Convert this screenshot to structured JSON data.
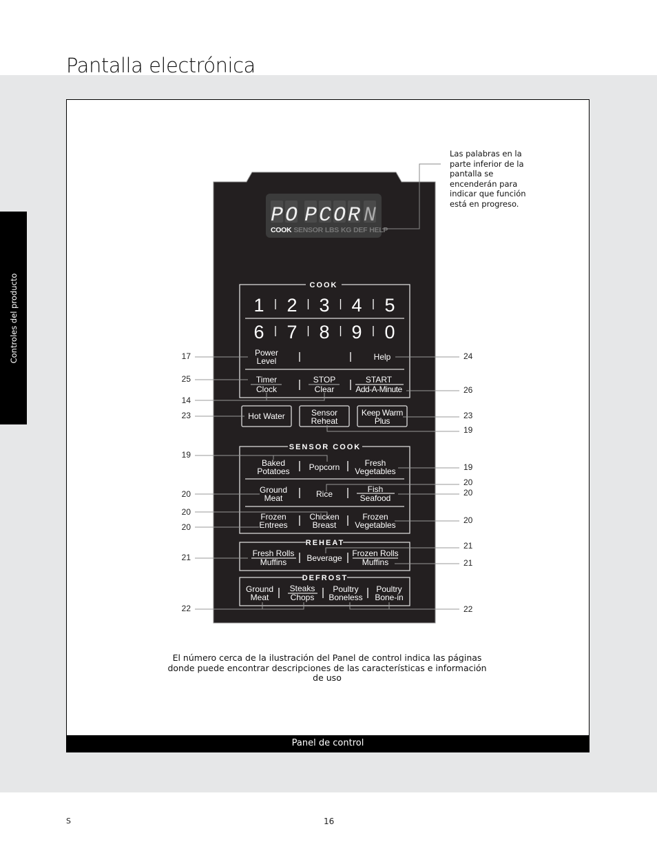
{
  "page": {
    "title": "Pantalla electrónica",
    "side_tab": "Controles del producto",
    "footer_left": "S",
    "page_number": "16",
    "caption": "Panel de control"
  },
  "display": {
    "readout": "POPCORN",
    "indicators": [
      {
        "label": "COOK",
        "active": true
      },
      {
        "label": "SENSOR",
        "active": false
      },
      {
        "label": "LBS",
        "active": false
      },
      {
        "label": "KG",
        "active": false
      },
      {
        "label": "DEF",
        "active": false
      },
      {
        "label": "HELP",
        "active": false
      }
    ],
    "note": "Las palabras en la parte inferior de la pantalla se encenderán para indicar que función está en progreso."
  },
  "cook": {
    "heading": "COOK",
    "row1": [
      "1",
      "2",
      "3",
      "4",
      "5"
    ],
    "row2": [
      "6",
      "7",
      "8",
      "9",
      "0"
    ],
    "power_level": [
      "Power",
      "Level"
    ],
    "help": "Help",
    "timer": "Timer",
    "clock": "Clock",
    "stop": "STOP",
    "clear": "Clear",
    "start": "START",
    "add_minute": "Add-A-Minute"
  },
  "quick": {
    "hot_water": "Hot Water",
    "sensor_reheat": [
      "Sensor",
      "Reheat"
    ],
    "keep_warm": [
      "Keep Warm",
      "Plus"
    ]
  },
  "sensor_cook": {
    "heading": "SENSOR COOK",
    "baked_potatoes": [
      "Baked",
      "Potatoes"
    ],
    "popcorn": "Popcorn",
    "fresh_vegetables": [
      "Fresh",
      "Vegetables"
    ],
    "ground_meat": [
      "Ground",
      "Meat"
    ],
    "rice": "Rice",
    "fish": "Fish",
    "seafood": "Seafood",
    "frozen_entrees": [
      "Frozen",
      "Entrees"
    ],
    "chicken_breast": [
      "Chicken",
      "Breast"
    ],
    "frozen_vegetables": [
      "Frozen",
      "Vegetables"
    ]
  },
  "reheat": {
    "heading": "REHEAT",
    "fresh_rolls": "Fresh Rolls",
    "muffins_a": "Muffins",
    "beverage": "Beverage",
    "frozen_rolls": "Frozen Rolls",
    "muffins_b": "Muffins"
  },
  "defrost": {
    "heading": "DEFROST",
    "ground_meat": [
      "Ground",
      "Meat"
    ],
    "steaks": "Steaks",
    "chops": "Chops",
    "poultry_boneless": [
      "Poultry",
      "Boneless"
    ],
    "poultry_bonein": [
      "Poultry",
      "Bone-in"
    ]
  },
  "callouts_left": [
    "17",
    "25",
    "14",
    "23",
    "19",
    "20",
    "20",
    "20",
    "21",
    "22"
  ],
  "callouts_right": [
    "24",
    "26",
    "23",
    "19",
    "19",
    "20",
    "20",
    "20",
    "21",
    "21",
    "22"
  ],
  "bottom_note": "El número cerca de la ilustración del Panel de control indica las páginas donde puede encontrar descripciones de las características e información de uso"
}
